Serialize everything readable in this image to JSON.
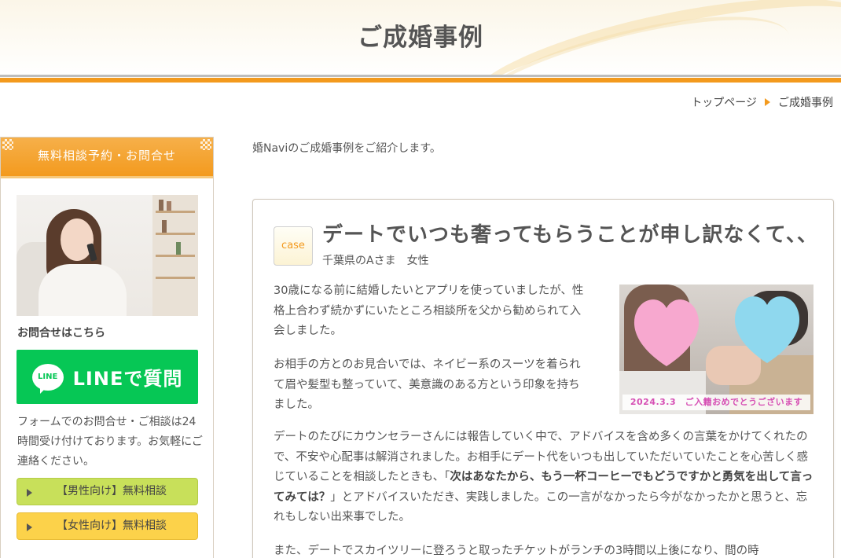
{
  "header": {
    "title": "ご成婚事例"
  },
  "breadcrumb": {
    "home": "トップページ",
    "current": "ご成婚事例"
  },
  "sidebar": {
    "heading": "無料相談予約・お問合せ",
    "contact_label": "お問合せはこちら",
    "line_icon_text": "LINE",
    "line_button_label": "LINEで質問",
    "note": "フォームでのお問合せ・ご相談は24時間受け付けております。お気軽にご連絡ください。",
    "men_button": "【男性向け】無料相談",
    "women_button": "【女性向け】無料相談"
  },
  "main": {
    "intro": "婚Naviのご成婚事例をご紹介します。",
    "case": {
      "badge": "case",
      "title": "デートでいつも奢ってもらうことが申し訳なくて､､",
      "meta": "千葉県のAさま　女性",
      "photo_caption": "2024.3.3　ご入籍おめでとうございます",
      "paragraph1": "30歳になる前に結婚したいとアプリを使っていましたが、性格上合わず続かずにいたところ相談所を父から勧められて入会しました。",
      "paragraph2": "お相手の方とのお見合いでは、ネイビー系のスーツを着られて眉や髪型も整っていて、美意識のある方という印象を持ちました。",
      "paragraph3_before": "デートのたびにカウンセラーさんには報告していく中で、アドバイスを含め多くの言葉をかけてくれたので、不安や心配事は解消されました。お相手にデート代をいつも出していただいていたことを心苦しく感じていることを相談したときも、「",
      "paragraph3_bold": "次はあなたから、もう一杯コーヒーでもどうですかと勇気を出して言ってみては？",
      "paragraph3_after": "」とアドバイスいただき、実践しました。この一言がなかったら今がなかったかと思うと、忘れもしない出来事でした。",
      "paragraph4": "また、デートでスカイツリーに登ろうと取ったチケットがランチの3時間以上後になり、間の時"
    }
  },
  "colors": {
    "accent_orange": "#f39a1e",
    "line_green": "#06c755",
    "men_green": "#c8e05a",
    "women_yellow": "#fcd24a",
    "heart_pink": "#f7a8cf",
    "heart_blue": "#8fd8ee"
  },
  "icons": {
    "breadcrumb_separator": "triangle-right-icon",
    "button_arrow": "triangle-right-icon",
    "line_logo": "line-logo-icon"
  }
}
